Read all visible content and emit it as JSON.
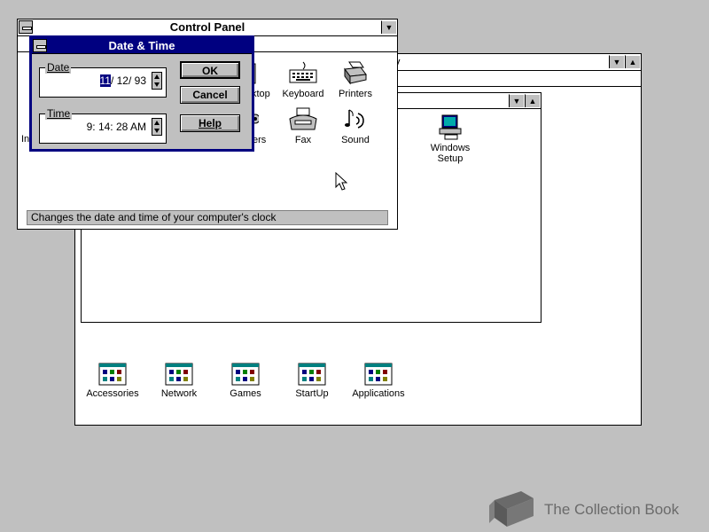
{
  "control_panel": {
    "title": "Control Panel",
    "icons": [
      {
        "label": "Desktop",
        "visible_label": "ktop",
        "icon": "desktop-icon"
      },
      {
        "label": "Keyboard",
        "icon": "keyboard-icon"
      },
      {
        "label": "Printers",
        "icon": "printer-icon"
      },
      {
        "label": "Drivers",
        "visible_label": "ers",
        "icon": "drivers-icon"
      },
      {
        "label": "Fax",
        "icon": "fax-icon"
      },
      {
        "label": "Sound",
        "icon": "sound-icon"
      },
      {
        "label": "International",
        "visible_label": "In",
        "icon": "globe-icon"
      }
    ],
    "status": "Changes the date and time of your computer's clock"
  },
  "main_window": {
    "title_fragment": "y",
    "groups": [
      {
        "label": "Accessories"
      },
      {
        "label": "Network"
      },
      {
        "label": "Games"
      },
      {
        "label": "StartUp"
      },
      {
        "label": "Applications"
      }
    ]
  },
  "main_group": {
    "icons": [
      {
        "label_line1": "Windows",
        "label_line2": "Setup",
        "icon": "windows-setup-icon"
      }
    ],
    "fragment": "s"
  },
  "dialog": {
    "title": "Date & Time",
    "date_label": "Date",
    "date_month": "11",
    "date_rest": "/ 12/ 93",
    "time_label": "Time",
    "time_value": "9: 14: 28 AM",
    "ok": "OK",
    "cancel": "Cancel",
    "help": "Help"
  },
  "watermark": "The Collection Book",
  "colors": {
    "active_title": "#000080",
    "desktop": "#c0c0c0"
  }
}
